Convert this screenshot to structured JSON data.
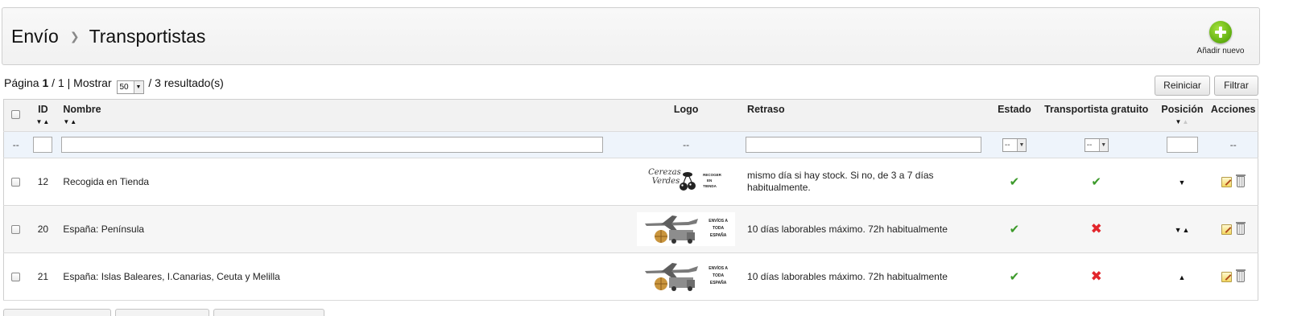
{
  "header": {
    "breadcrumb_parent": "Envío",
    "breadcrumb_current": "Transportistas",
    "add_new_label": "Añadir nuevo"
  },
  "pagination": {
    "label_page": "Página",
    "current_page": "1",
    "total_pages_text": "/ 1 | Mostrar",
    "per_page": "50",
    "results_text": "/ 3 resultado(s)"
  },
  "buttons": {
    "reset": "Reiniciar",
    "filter": "Filtrar"
  },
  "columns": {
    "id": "ID",
    "name": "Nombre",
    "logo": "Logo",
    "delay": "Retraso",
    "status": "Estado",
    "free": "Transportista gratuito",
    "position": "Posición",
    "actions": "Acciones"
  },
  "filters": {
    "checkbox_placeholder": "--",
    "logo_placeholder": "--",
    "status_select": "--",
    "free_select": "--",
    "actions_placeholder": "--"
  },
  "rows": [
    {
      "id": "12",
      "name": "Recogida en Tienda",
      "delay": "mismo día si hay stock. Si no, de 3 a 7 días habitualmente.",
      "status": "enabled",
      "free": "yes",
      "logo_text_1": "Cerezas",
      "logo_text_2": "Verdes",
      "logo_text_3": "RECOGER EN TIENDA"
    },
    {
      "id": "20",
      "name": "España: Península",
      "delay": "10 días laborables máximo. 72h habitualmente",
      "status": "enabled",
      "free": "no",
      "logo_text_1": "ENVÍOS A TODA ESPAÑA"
    },
    {
      "id": "21",
      "name": "España: Islas Baleares, I.Canarias, Ceuta y Melilla",
      "delay": "10 días laborables máximo. 72h habitualmente",
      "status": "enabled",
      "free": "no",
      "logo_text_1": "ENVÍOS A TODA ESPAÑA"
    }
  ],
  "icons": {
    "check": "check-icon",
    "cross": "cross-icon",
    "edit": "edit-icon",
    "delete": "trash-icon"
  },
  "colors": {
    "check": "#3c9a2a",
    "cross": "#e2262c",
    "add_button": "#5fae10"
  }
}
